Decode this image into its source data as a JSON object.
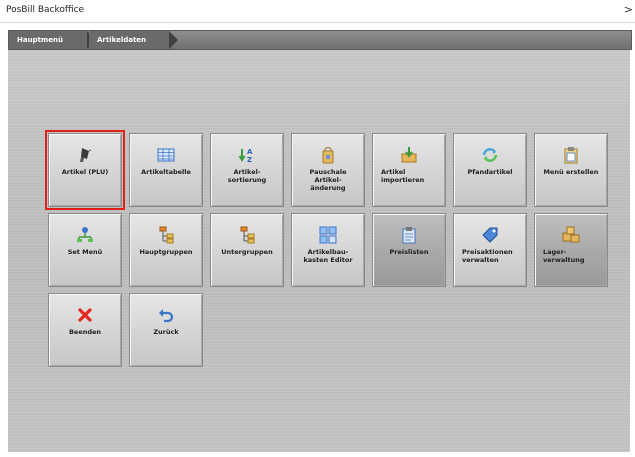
{
  "window": {
    "title": "PosBill Backoffice",
    "close_glyph": ">"
  },
  "breadcrumb": {
    "items": [
      "Hauptmenü",
      "Artikeldaten"
    ]
  },
  "tiles": [
    {
      "label": "Artikel (PLU)",
      "icon": "scanner-icon",
      "align": "center",
      "selected": true
    },
    {
      "label": "Artikeltabelle",
      "icon": "table-icon",
      "align": "center"
    },
    {
      "label": "Artikel-\nsortierung",
      "icon": "sort-az-icon",
      "align": "center"
    },
    {
      "label": "Pauschale\nArtikel-\nänderung",
      "icon": "bag-icon",
      "align": "center"
    },
    {
      "label": "Artikel\nimportieren",
      "icon": "import-box-icon",
      "align": "left"
    },
    {
      "label": "Pfandartikel",
      "icon": "recycle-icon",
      "align": "center"
    },
    {
      "label": "Menü erstellen",
      "icon": "clipboard-icon",
      "align": "center"
    },
    {
      "label": "Set Menü",
      "icon": "hierarchy-icon",
      "align": "center"
    },
    {
      "label": "Hauptgruppen",
      "icon": "tree-icon",
      "align": "center"
    },
    {
      "label": "Untergruppen",
      "icon": "tree-icon",
      "align": "center"
    },
    {
      "label": "Artikelbau-\nkasten Editor",
      "icon": "grid-blocks-icon",
      "align": "center"
    },
    {
      "label": "Preislisten",
      "icon": "price-list-icon",
      "align": "center",
      "dark": true
    },
    {
      "label": "Preisaktionen\nverwalten",
      "icon": "price-tag-icon",
      "align": "left"
    },
    {
      "label": "Lager-\nverwaltung",
      "icon": "boxes-icon",
      "align": "left",
      "dark": true
    },
    {
      "label": "Beenden",
      "icon": "close-x-icon",
      "align": "center"
    },
    {
      "label": "Zurück",
      "icon": "undo-arrow-icon",
      "align": "center"
    }
  ],
  "colors": {
    "selected_outline": "#e1201e",
    "breadcrumb_bg": "#6a6a6a"
  }
}
